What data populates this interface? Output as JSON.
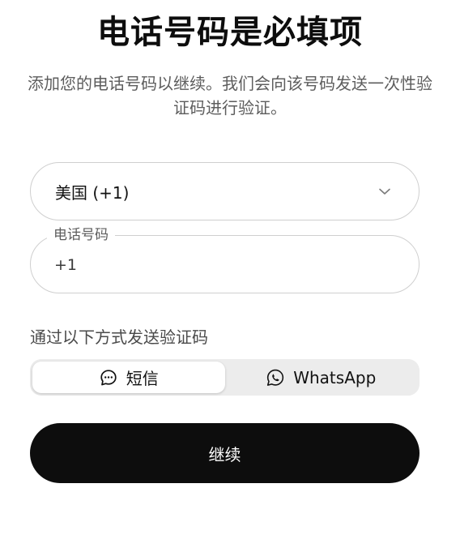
{
  "header": {
    "title": "电话号码是必填项",
    "subtitle": "添加您的电话号码以继续。我们会向该号码发送一次性验证码进行验证。"
  },
  "country_select": {
    "value": "美国 (+1)",
    "icon": "chevron-down-icon"
  },
  "phone_field": {
    "label": "电话号码",
    "value": "+1"
  },
  "verification": {
    "label": "通过以下方式发送验证码",
    "options": [
      {
        "label": "短信",
        "icon": "message-bubble-icon",
        "selected": true
      },
      {
        "label": "WhatsApp",
        "icon": "whatsapp-icon",
        "selected": false
      }
    ]
  },
  "actions": {
    "continue_label": "继续"
  },
  "colors": {
    "button_bg": "#0d0d0d",
    "button_text": "#ffffff",
    "border": "#cfcfcf",
    "segment_bg": "#ececec",
    "muted_text": "#5d5d5d"
  }
}
